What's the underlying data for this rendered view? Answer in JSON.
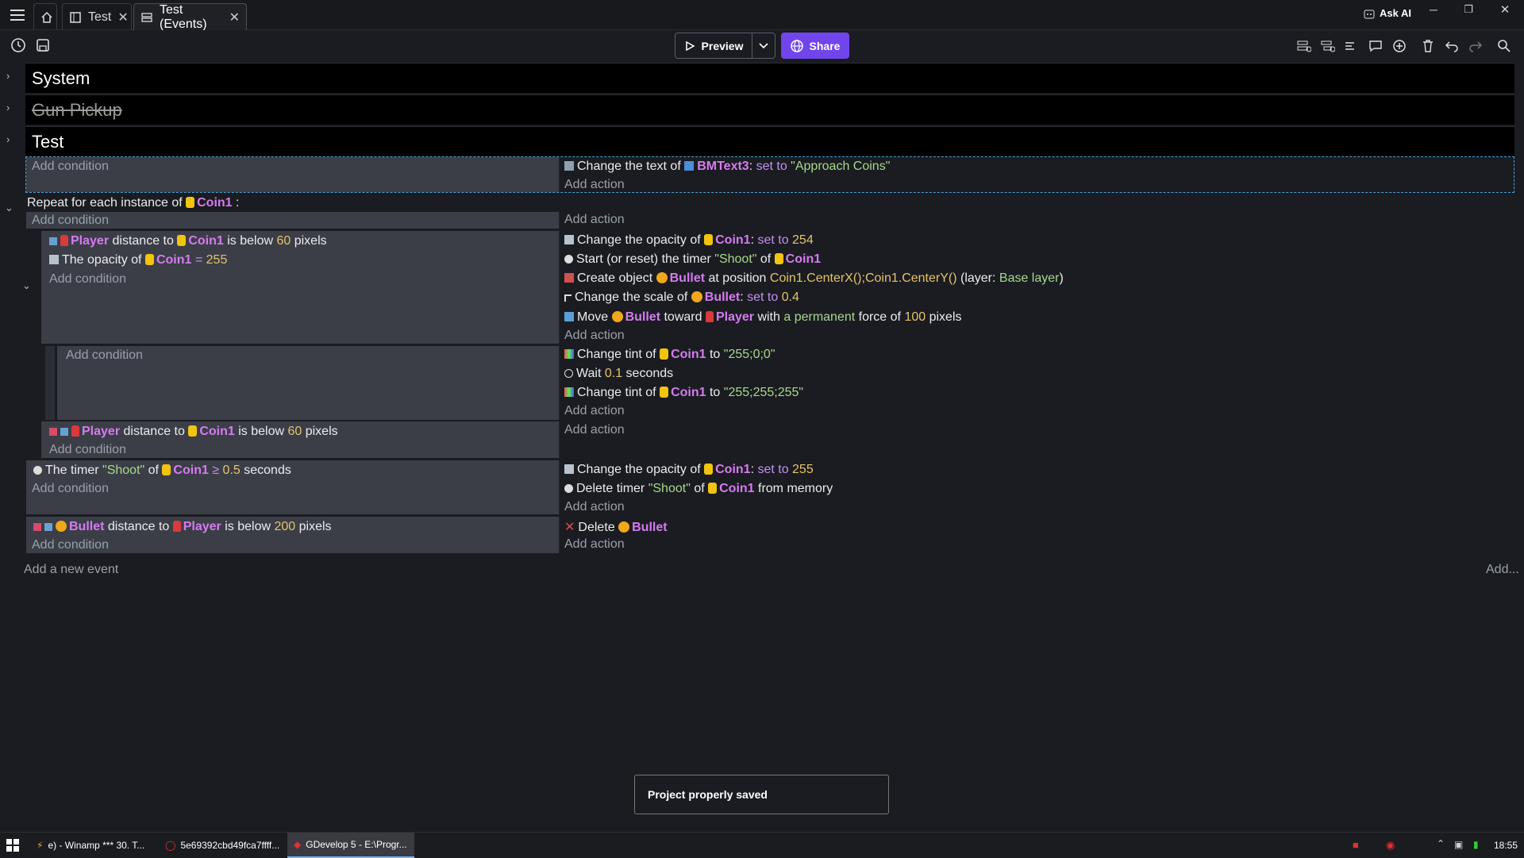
{
  "titlebar": {
    "tabs": [
      {
        "label": "Test"
      },
      {
        "label": "Test (Events)"
      }
    ],
    "ask_ai": "Ask AI"
  },
  "toolbar": {
    "preview_label": "Preview",
    "share_label": "Share"
  },
  "groups": [
    {
      "label": "System"
    },
    {
      "label": "Gun Pickup"
    },
    {
      "label": "Test"
    }
  ],
  "events": {
    "add_condition": "Add condition",
    "add_action": "Add action",
    "e1_action": {
      "pre": "Change the text of ",
      "obj": "BMText3",
      "mid": ": ",
      "op": "set to ",
      "val": "\"Approach Coins\""
    },
    "repeat": {
      "pre": "Repeat for each instance of ",
      "obj": "Coin1",
      "post": " :"
    },
    "c1a": {
      "obj1": "Player",
      "mid": " distance to ",
      "obj2": "Coin1",
      "post": " is below ",
      "num": "60",
      "unit": " pixels"
    },
    "c1b": {
      "pre": "The opacity of ",
      "obj": "Coin1",
      "op": " = ",
      "num": "255"
    },
    "a1": {
      "pre": "Change the opacity of ",
      "obj": "Coin1",
      "mid": ": ",
      "op": "set to ",
      "num": "254"
    },
    "a2": {
      "pre": "Start (or reset) the timer ",
      "str": "\"Shoot\"",
      "mid": " of ",
      "obj": "Coin1"
    },
    "a3": {
      "pre": "Create object ",
      "obj": "Bullet",
      "mid": " at position ",
      "val": "Coin1.CenterX();Coin1.CenterY()",
      "post1": " (layer: ",
      "layer": "Base layer",
      "post2": ")"
    },
    "a4": {
      "pre": "Change the scale of ",
      "obj": "Bullet",
      "mid": ": ",
      "op": "set to ",
      "num": "0.4"
    },
    "a5": {
      "pre": "Move ",
      "obj1": "Bullet",
      "mid": " toward ",
      "obj2": "Player",
      "w": " with ",
      "perm": "a permanent",
      "f": " force of ",
      "num": "100",
      "unit": " pixels"
    },
    "a6": {
      "pre": "Change tint of ",
      "obj": "Coin1",
      "mid": " to ",
      "str": "\"255;0;0\""
    },
    "a7": {
      "pre": "Wait ",
      "num": "0.1",
      "unit": " seconds"
    },
    "a8": {
      "pre": "Change tint of ",
      "obj": "Coin1",
      "mid": " to ",
      "str": "\"255;255;255\""
    },
    "c3": {
      "obj1": "Player",
      "mid": " distance to ",
      "obj2": "Coin1",
      "post": " is below ",
      "num": "60",
      "unit": " pixels"
    },
    "c4": {
      "pre": "The timer ",
      "str": "\"Shoot\"",
      "mid": " of ",
      "obj": "Coin1",
      "op": " ≥ ",
      "num": "0.5",
      "unit": " seconds"
    },
    "a9": {
      "pre": "Change the opacity of ",
      "obj": "Coin1",
      "mid": ": ",
      "op": "set to ",
      "num": "255"
    },
    "a10": {
      "pre": "Delete timer ",
      "str": "\"Shoot\"",
      "mid": " of ",
      "obj": "Coin1",
      "post": " from memory"
    },
    "c5": {
      "obj1": "Bullet",
      "mid": " distance to ",
      "obj2": "Player",
      "post": " is below ",
      "num": "200",
      "unit": " pixels"
    },
    "a11": {
      "pre": "Delete ",
      "obj": "Bullet"
    },
    "add_new_event": "Add a new event",
    "add_more": "Add..."
  },
  "toast": "Project properly saved",
  "taskbar": {
    "apps": [
      {
        "label": "e) - Winamp *** 30. T..."
      },
      {
        "label": "5e69392cbd49fca7ffff..."
      },
      {
        "label": "GDevelop 5 - E:\\Progr..."
      }
    ],
    "clock": "18:55"
  }
}
